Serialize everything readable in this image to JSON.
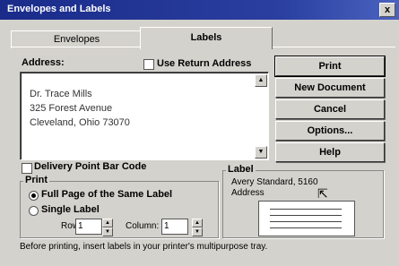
{
  "window": {
    "title": "Envelopes and Labels",
    "close_glyph": "x"
  },
  "tabs": [
    {
      "label": "Envelopes",
      "selected": false
    },
    {
      "label": "Labels",
      "selected": true
    }
  ],
  "address": {
    "label": "Address:",
    "use_return_address": "Use Return Address",
    "lines": [
      "Dr. Trace Mills",
      "325 Forest Avenue",
      "Cleveland, Ohio 73070"
    ]
  },
  "buttons": {
    "print": "Print",
    "new_document": "New Document",
    "cancel": "Cancel",
    "options": "Options...",
    "help": "Help"
  },
  "delivery_point": "Delivery Point Bar Code",
  "print_group": {
    "title": "Print",
    "full_page": "Full Page of the Same Label",
    "single_label": "Single Label",
    "row_label": "Row:",
    "row_value": "1",
    "column_label": "Column:",
    "column_value": "1",
    "selected": "full_page"
  },
  "label_group": {
    "title": "Label",
    "product": "Avery Standard, 5160",
    "type": "Address"
  },
  "footer": "Before printing, insert labels in your printer's multipurpose tray."
}
